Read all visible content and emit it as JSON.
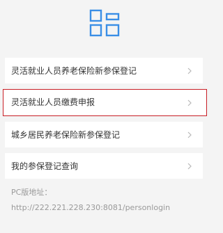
{
  "colors": {
    "accent": "#3a8ee6",
    "selected_border": "#c81e25",
    "background": "#f4f4f4",
    "item_background": "#ffffff",
    "text": "#333333",
    "muted_text": "#999999"
  },
  "header": {
    "icon": "grid-apps-icon"
  },
  "menu": {
    "items": [
      {
        "label": "灵活就业人员养老保险新参保登记",
        "icon": "chevron-right-icon",
        "selected": false
      },
      {
        "label": "灵活就业人员缴费申报",
        "icon": "chevron-right-icon",
        "selected": true
      },
      {
        "label": "城乡居民养老保险新参保登记",
        "icon": "chevron-right-icon",
        "selected": false
      },
      {
        "label": "我的参保登记查询",
        "icon": "chevron-right-icon",
        "selected": false
      }
    ]
  },
  "footer": {
    "pc_label": "PC版地址：",
    "pc_url": "http://222.221.228.230:8081/personlogin"
  }
}
